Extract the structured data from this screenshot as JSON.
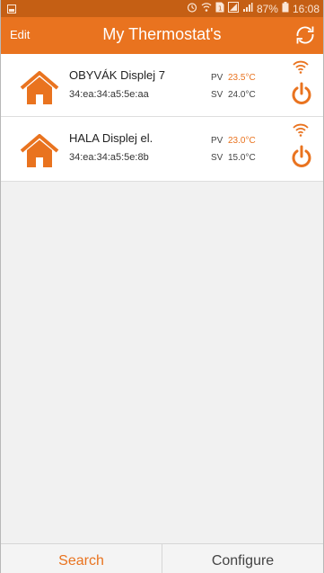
{
  "status_bar": {
    "battery": "87%",
    "time": "16:08"
  },
  "app_bar": {
    "edit_label": "Edit",
    "title": "My Thermostat's"
  },
  "devices": [
    {
      "name": "OBYVÁK Displej 7",
      "mac": "34:ea:34:a5:5e:aa",
      "pv_label": "PV",
      "pv_value": "23.5°C",
      "sv_label": "SV",
      "sv_value": "24.0°C"
    },
    {
      "name": "HALA Displej el.",
      "mac": "34:ea:34:a5:5e:8b",
      "pv_label": "PV",
      "pv_value": "23.0°C",
      "sv_label": "SV",
      "sv_value": "15.0°C"
    }
  ],
  "bottom_bar": {
    "search_label": "Search",
    "configure_label": "Configure"
  },
  "colors": {
    "accent": "#e9731f",
    "status_bar": "#c55f14",
    "background": "#f1f1f1"
  },
  "icons": {
    "status_left": "image-icon",
    "refresh": "refresh-icon",
    "device": "house-icon",
    "wifi": "wifi-icon",
    "power": "power-icon"
  }
}
